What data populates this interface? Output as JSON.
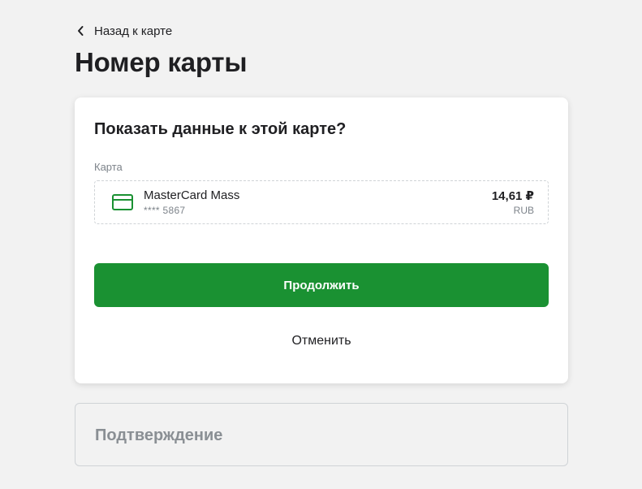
{
  "nav": {
    "back_label": "Назад к карте"
  },
  "header": {
    "title": "Номер карты"
  },
  "dialog": {
    "question": "Показать данные к этой карте?",
    "field_label": "Карта",
    "selected_card": {
      "name": "MasterCard Mass",
      "masked_number": "**** 5867",
      "balance": "14,61 ₽",
      "currency": "RUB",
      "icon": "credit-card-icon"
    },
    "continue_label": "Продолжить",
    "cancel_label": "Отменить"
  },
  "confirmation": {
    "title": "Подтверждение"
  },
  "colors": {
    "primary": "#1a9132",
    "background": "#f2f2f2",
    "card_surface": "#ffffff",
    "muted_text": "#7d838a",
    "disabled_title": "#8a8f94"
  }
}
